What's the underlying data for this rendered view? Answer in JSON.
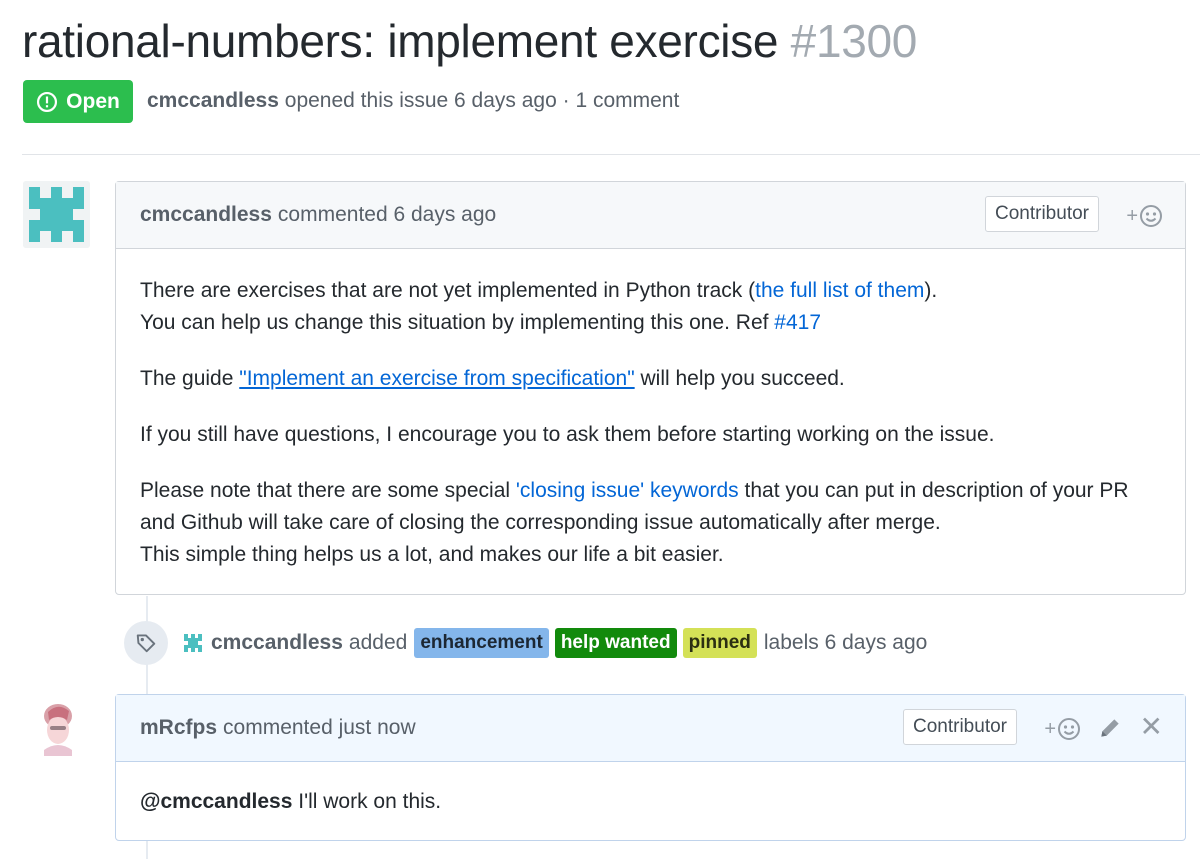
{
  "issue": {
    "title": "rational-numbers: implement exercise",
    "number": "#1300",
    "state": "Open",
    "author": "cmccandless",
    "meta_text": "opened this issue 6 days ago · 1 comment",
    "colors": {
      "open_green": "#2cbe4e",
      "link_blue": "#0366d6"
    }
  },
  "comments": [
    {
      "author": "cmccandless",
      "header_text": "commented 6 days ago",
      "badge": "Contributor",
      "reaction_plus": "+",
      "reaction_icon": "smiley-icon",
      "body": {
        "p1_a": "There are exercises that are not yet implemented in Python track (",
        "p1_link": "the full list of them",
        "p1_b": ").",
        "p1_c": "You can help us change this situation by implementing this one. Ref ",
        "p1_ref": "#417",
        "p2_a": "The guide ",
        "p2_link": "\"Implement an exercise from specification\"",
        "p2_b": " will help you succeed.",
        "p3": "If you still have questions, I encourage you to ask them before starting working on the issue.",
        "p4_a": "Please note that there are some special ",
        "p4_link": "'closing issue' keywords",
        "p4_b": " that you can put in description of your PR and Github will take care of closing the corresponding issue automatically after merge.",
        "p4_c": "This simple thing helps us a lot, and makes our life a bit easier."
      }
    },
    {
      "author": "mRcfps",
      "header_text": "commented just now",
      "badge": "Contributor",
      "reaction_plus": "+",
      "reaction_icon": "smiley-icon",
      "edit_icon": "pencil-icon",
      "close_glyph": "✕",
      "body": {
        "mention": "@cmccandless",
        "text": " I'll work on this."
      }
    }
  ],
  "label_event": {
    "icon": "tag-icon",
    "actor": "cmccandless",
    "verb": "added",
    "labels": [
      {
        "name": "enhancement",
        "color": "#84b6eb"
      },
      {
        "name": "help wanted",
        "color": "#128a0c"
      },
      {
        "name": "pinned",
        "color": "#d4e157"
      }
    ],
    "tail": "labels 6 days ago"
  }
}
